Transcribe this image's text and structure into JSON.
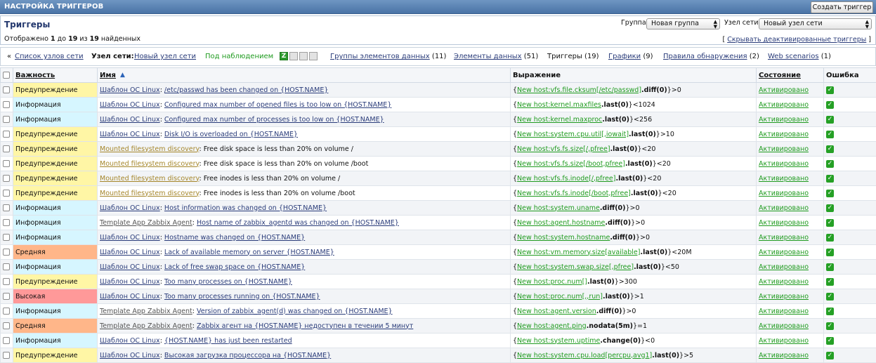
{
  "header": {
    "title": "НАСТРОЙКА ТРИГГЕРОВ",
    "create_button": "Создать триггер"
  },
  "subheader": {
    "heading": "Триггеры",
    "shown_prefix": "Отображено",
    "shown_from": "1",
    "shown_to_word": "до",
    "shown_to": "19",
    "shown_of_word": "из",
    "shown_total": "19",
    "shown_suffix": "найденных",
    "group_label": "Группа",
    "group_value": "Новая группа",
    "host_label": "Узел сети",
    "host_value": "Новый узел сети",
    "hide_deactivated": "Скрывать деактивированные триггеры"
  },
  "nav": {
    "back_arrow": "«",
    "host_list": "Список узлов сети",
    "host_label": "Узел сети:",
    "host_name": "Новый узел сети",
    "monitored": "Под наблюдением",
    "z_icon": "Z",
    "item_groups": "Группы элементов данных",
    "item_groups_count": "(11)",
    "items": "Элементы данных",
    "items_count": "(51)",
    "triggers": "Триггеры",
    "triggers_count": "(19)",
    "graphs": "Графики",
    "graphs_count": "(9)",
    "discovery": "Правила обнаружения",
    "discovery_count": "(2)",
    "web": "Web scenarios",
    "web_count": "(1)"
  },
  "table": {
    "columns": {
      "severity": "Важность",
      "name": "Имя",
      "expression": "Выражение",
      "status": "Состояние",
      "error": "Ошибка"
    },
    "rows": [
      {
        "severity": "Предупреждение",
        "sev_class": "warning",
        "template": "Шаблон ОС Linux",
        "tpl_style": "dark",
        "name": "/etc/passwd has been changed on {HOST.NAME}",
        "name_link": true,
        "expr_key": "New host:vfs.file.cksum[/etc/passwd]",
        "expr_fn": ".diff(0)",
        "expr_tail": "}>0",
        "status": "Активировано"
      },
      {
        "severity": "Информация",
        "sev_class": "info",
        "template": "Шаблон ОС Linux",
        "tpl_style": "dark",
        "name": "Configured max number of opened files is too low on {HOST.NAME}",
        "name_link": true,
        "expr_key": "New host:kernel.maxfiles",
        "expr_fn": ".last(0)",
        "expr_tail": "}<1024",
        "status": "Активировано"
      },
      {
        "severity": "Информация",
        "sev_class": "info",
        "template": "Шаблон ОС Linux",
        "tpl_style": "dark",
        "name": "Configured max number of processes is too low on {HOST.NAME}",
        "name_link": true,
        "expr_key": "New host:kernel.maxproc",
        "expr_fn": ".last(0)",
        "expr_tail": "}<256",
        "status": "Активировано"
      },
      {
        "severity": "Предупреждение",
        "sev_class": "warning",
        "template": "Шаблон ОС Linux",
        "tpl_style": "dark",
        "name": "Disk I/O is overloaded on {HOST.NAME}",
        "name_link": true,
        "expr_key": "New host:system.cpu.util[,iowait]",
        "expr_fn": ".last(0)",
        "expr_tail": "}>10",
        "status": "Активировано"
      },
      {
        "severity": "Предупреждение",
        "sev_class": "warning",
        "template": "Mounted filesystem discovery",
        "tpl_style": "gold",
        "name": "Free disk space is less than 20% on volume /",
        "name_link": false,
        "expr_key": "New host:vfs.fs.size[/,pfree]",
        "expr_fn": ".last(0)",
        "expr_tail": "}<20",
        "expr_plain": true,
        "status": "Активировано"
      },
      {
        "severity": "Предупреждение",
        "sev_class": "warning",
        "template": "Mounted filesystem discovery",
        "tpl_style": "gold",
        "name": "Free disk space is less than 20% on volume /boot",
        "name_link": false,
        "expr_key": "New host:vfs.fs.size[/boot,pfree]",
        "expr_fn": ".last(0)",
        "expr_tail": "}<20",
        "expr_plain": true,
        "status": "Активировано"
      },
      {
        "severity": "Предупреждение",
        "sev_class": "warning",
        "template": "Mounted filesystem discovery",
        "tpl_style": "gold",
        "name": "Free inodes is less than 20% on volume /",
        "name_link": false,
        "expr_key": "New host:vfs.fs.inode[/,pfree]",
        "expr_fn": ".last(0)",
        "expr_tail": "}<20",
        "expr_plain": true,
        "status": "Активировано"
      },
      {
        "severity": "Предупреждение",
        "sev_class": "warning",
        "template": "Mounted filesystem discovery",
        "tpl_style": "gold",
        "name": "Free inodes is less than 20% on volume /boot",
        "name_link": false,
        "expr_key": "New host:vfs.fs.inode[/boot,pfree]",
        "expr_fn": ".last(0)",
        "expr_tail": "}<20",
        "expr_plain": true,
        "status": "Активировано"
      },
      {
        "severity": "Информация",
        "sev_class": "info",
        "template": "Шаблон ОС Linux",
        "tpl_style": "dark",
        "name": "Host information was changed on {HOST.NAME}",
        "name_link": true,
        "expr_key": "New host:system.uname",
        "expr_fn": ".diff(0)",
        "expr_tail": "}>0",
        "status": "Активировано"
      },
      {
        "severity": "Информация",
        "sev_class": "info",
        "template": "Template App Zabbix Agent",
        "tpl_style": "gray",
        "name": "Host name of zabbix_agentd was changed on {HOST.NAME}",
        "name_link": true,
        "expr_key": "New host:agent.hostname",
        "expr_fn": ".diff(0)",
        "expr_tail": "}>0",
        "status": "Активировано"
      },
      {
        "severity": "Информация",
        "sev_class": "info",
        "template": "Шаблон ОС Linux",
        "tpl_style": "dark",
        "name": "Hostname was changed on {HOST.NAME}",
        "name_link": true,
        "expr_key": "New host:system.hostname",
        "expr_fn": ".diff(0)",
        "expr_tail": "}>0",
        "status": "Активировано"
      },
      {
        "severity": "Средняя",
        "sev_class": "average",
        "template": "Шаблон ОС Linux",
        "tpl_style": "dark",
        "name": "Lack of available memory on server {HOST.NAME}",
        "name_link": true,
        "expr_key": "New host:vm.memory.size[available]",
        "expr_fn": ".last(0)",
        "expr_tail": "}<20M",
        "status": "Активировано"
      },
      {
        "severity": "Информация",
        "sev_class": "info",
        "template": "Шаблон ОС Linux",
        "tpl_style": "dark",
        "name": "Lack of free swap space on {HOST.NAME}",
        "name_link": true,
        "expr_key": "New host:system.swap.size[,pfree]",
        "expr_fn": ".last(0)",
        "expr_tail": "}<50",
        "status": "Активировано"
      },
      {
        "severity": "Предупреждение",
        "sev_class": "warning",
        "template": "Шаблон ОС Linux",
        "tpl_style": "dark",
        "name": "Too many processes on {HOST.NAME}",
        "name_link": true,
        "expr_key": "New host:proc.num[]",
        "expr_fn": ".last(0)",
        "expr_tail": "}>300",
        "status": "Активировано"
      },
      {
        "severity": "Высокая",
        "sev_class": "high",
        "template": "Шаблон ОС Linux",
        "tpl_style": "dark",
        "name": "Too many processes running on {HOST.NAME}",
        "name_link": true,
        "expr_key": "New host:proc.num[,,run]",
        "expr_fn": ".last(0)",
        "expr_tail": "}>1",
        "status": "Активировано"
      },
      {
        "severity": "Информация",
        "sev_class": "info",
        "template": "Template App Zabbix Agent",
        "tpl_style": "gray",
        "name": "Version of zabbix_agent(d) was changed on {HOST.NAME}",
        "name_link": true,
        "expr_key": "New host:agent.version",
        "expr_fn": ".diff(0)",
        "expr_tail": "}>0",
        "status": "Активировано"
      },
      {
        "severity": "Средняя",
        "sev_class": "average",
        "template": "Template App Zabbix Agent",
        "tpl_style": "gray",
        "name": "Zabbix агент на {HOST.NAME} недоступен в течении 5 минут",
        "name_link": true,
        "expr_key": "New host:agent.ping",
        "expr_fn": ".nodata(5m)",
        "expr_tail": "}=1",
        "status": "Активировано"
      },
      {
        "severity": "Информация",
        "sev_class": "info",
        "template": "Шаблон ОС Linux",
        "tpl_style": "dark",
        "name": "{HOST.NAME} has just been restarted",
        "name_link": true,
        "expr_key": "New host:system.uptime",
        "expr_fn": ".change(0)",
        "expr_tail": "}<0",
        "status": "Активировано"
      },
      {
        "severity": "Предупреждение",
        "sev_class": "warning",
        "template": "Шаблон ОС Linux",
        "tpl_style": "dark",
        "name": "Высокая загрузка процессора на {HOST.NAME}",
        "name_link": true,
        "expr_key": "New host:system.cpu.load[percpu,avg1]",
        "expr_fn": ".last(0)",
        "expr_tail": "}>5",
        "status": "Активировано"
      }
    ]
  }
}
